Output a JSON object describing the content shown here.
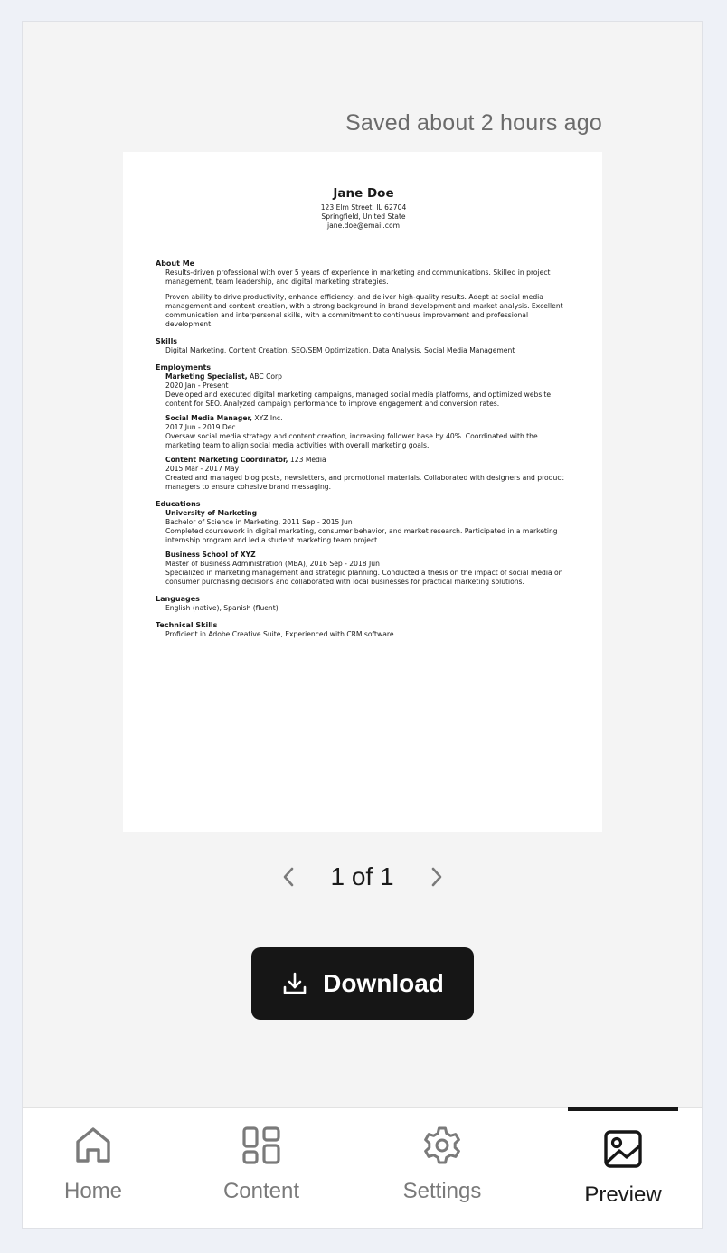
{
  "saved_status": "Saved about 2 hours ago",
  "resume": {
    "name": "Jane Doe",
    "address_line1": "123 Elm Street, IL 62704",
    "address_line2": "Springfield, United State",
    "email": "jane.doe@email.com",
    "about": {
      "heading": "About Me",
      "p1": "Results-driven professional with over 5 years of experience in marketing and communications. Skilled in project management, team leadership, and digital marketing strategies.",
      "p2": "Proven ability to drive productivity, enhance efficiency, and deliver high-quality results. Adept at social media management and content creation, with a strong background in brand development and market analysis. Excellent communication and interpersonal skills, with a commitment to continuous improvement and professional development."
    },
    "skills": {
      "heading": "Skills",
      "text": "Digital Marketing, Content Creation, SEO/SEM Optimization, Data Analysis, Social Media Management"
    },
    "employments": {
      "heading": "Employments",
      "items": [
        {
          "title": "Marketing Specialist,",
          "company": "ABC Corp",
          "dates": "2020 Jan - Present",
          "desc": "Developed and executed digital marketing campaigns, managed social media platforms, and optimized website content for SEO. Analyzed campaign performance to improve engagement and conversion rates."
        },
        {
          "title": "Social Media Manager,",
          "company": "XYZ Inc.",
          "dates": "2017 Jun - 2019 Dec",
          "desc": "Oversaw social media strategy and content creation, increasing follower base by 40%. Coordinated with the marketing team to align social media activities with overall marketing goals."
        },
        {
          "title": "Content Marketing Coordinator,",
          "company": "123 Media",
          "dates": "2015 Mar - 2017 May",
          "desc": "Created and managed blog posts, newsletters, and promotional materials. Collaborated with designers and product managers to ensure cohesive brand messaging."
        }
      ]
    },
    "educations": {
      "heading": "Educations",
      "items": [
        {
          "school": "University of Marketing",
          "degree": "Bachelor of Science in Marketing, 2011 Sep - 2015 Jun",
          "desc": "Completed coursework in digital marketing, consumer behavior, and market research. Participated in a marketing internship program and led a student marketing team project."
        },
        {
          "school": "Business School of XYZ",
          "degree": "Master of Business Administration (MBA), 2016 Sep - 2018 Jun",
          "desc": "Specialized in marketing management and strategic planning. Conducted a thesis on the impact of social media on consumer purchasing decisions and collaborated with local businesses for practical marketing solutions."
        }
      ]
    },
    "languages": {
      "heading": "Languages",
      "text": "English (native), Spanish (fluent)"
    },
    "technical": {
      "heading": "Technical Skills",
      "text": "Proficient in Adobe Creative Suite, Experienced with CRM software"
    }
  },
  "pager": {
    "label": "1 of 1",
    "prev_icon": "chevron-left-icon",
    "next_icon": "chevron-right-icon"
  },
  "download": {
    "label": "Download",
    "icon": "download-icon"
  },
  "nav": {
    "items": [
      {
        "label": "Home",
        "icon": "home-icon"
      },
      {
        "label": "Content",
        "icon": "grid-icon"
      },
      {
        "label": "Settings",
        "icon": "gear-icon"
      },
      {
        "label": "Preview",
        "icon": "image-icon",
        "active": true
      }
    ]
  },
  "colors": {
    "accent": "#161616",
    "page_bg": "#eef1f7",
    "panel_bg": "#f4f4f4",
    "muted_text": "#7a7a7a"
  }
}
